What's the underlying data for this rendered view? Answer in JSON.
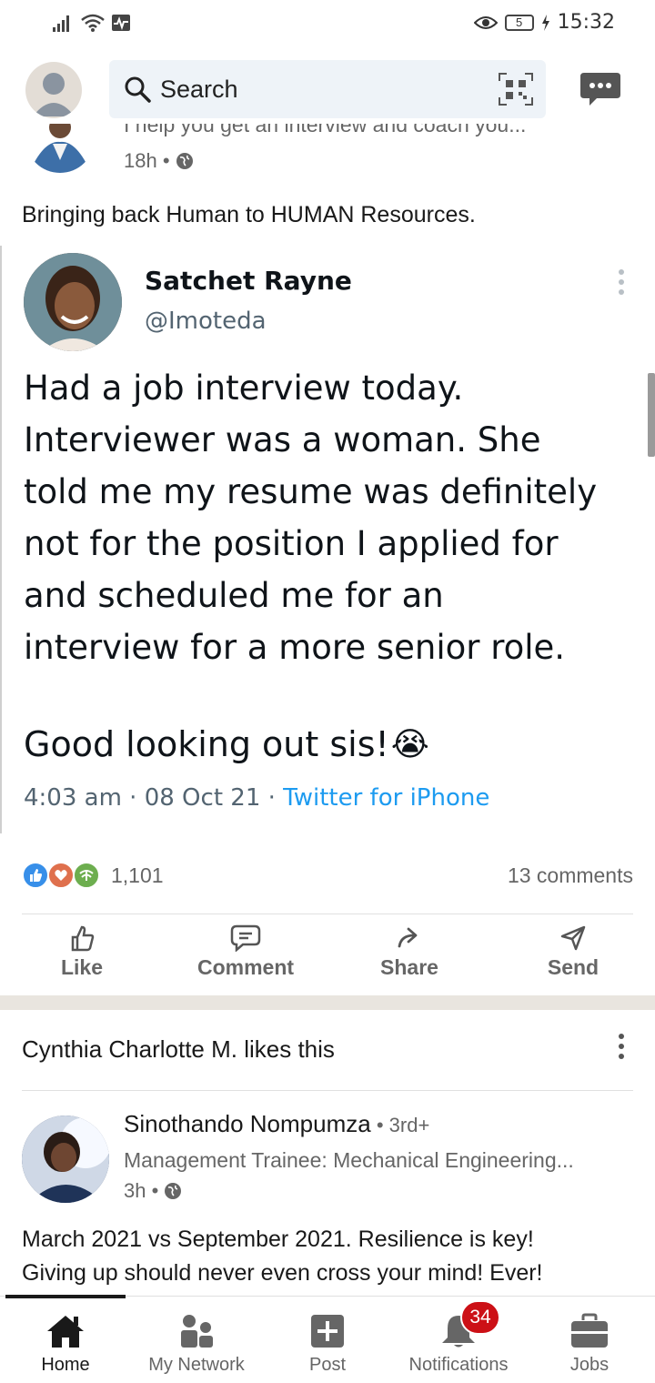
{
  "status_bar": {
    "battery": "5",
    "time": "15:32"
  },
  "header": {
    "search_placeholder": "Search"
  },
  "prev_post": {
    "headline": "I help you get an interview and coach you...",
    "time": "18h •"
  },
  "post": {
    "text": "Bringing back Human to HUMAN Resources.",
    "tweet": {
      "name": "Satchet Rayne",
      "handle": "@Imoteda",
      "lines": [
        "Had a job interview today.",
        "Interviewer was a woman. She",
        "told me my resume was definitely",
        "not for the position I applied for",
        "and scheduled me for an",
        "interview for a more senior role."
      ],
      "signoff": "Good looking out sis!",
      "emoji": "😭",
      "time": "4:03 am · 08 Oct 21 · ",
      "source": "Twitter for iPhone"
    },
    "reaction_count": "1,101",
    "comments": "13 comments",
    "actions": {
      "like": "Like",
      "comment": "Comment",
      "share": "Share",
      "send": "Send"
    }
  },
  "post2": {
    "social": "Cynthia Charlotte M. likes this",
    "name": "Sinothando Nompumza",
    "degree": " • 3rd+",
    "headline": "Management Trainee: Mechanical Engineering...",
    "time": "3h •",
    "text_line1": "March 2021 vs September 2021. Resilience is key!",
    "text_line2": "Giving up should never even cross your mind! Ever!"
  },
  "nav": {
    "home": "Home",
    "network": "My Network",
    "post": "Post",
    "notifications": "Notifications",
    "notifications_badge": "34",
    "jobs": "Jobs"
  },
  "colors": {
    "link": "#1d9bf0",
    "badge": "#cc1016",
    "like_blue": "#378fe9",
    "love_red": "#df704d",
    "support_green": "#6dae4f"
  }
}
